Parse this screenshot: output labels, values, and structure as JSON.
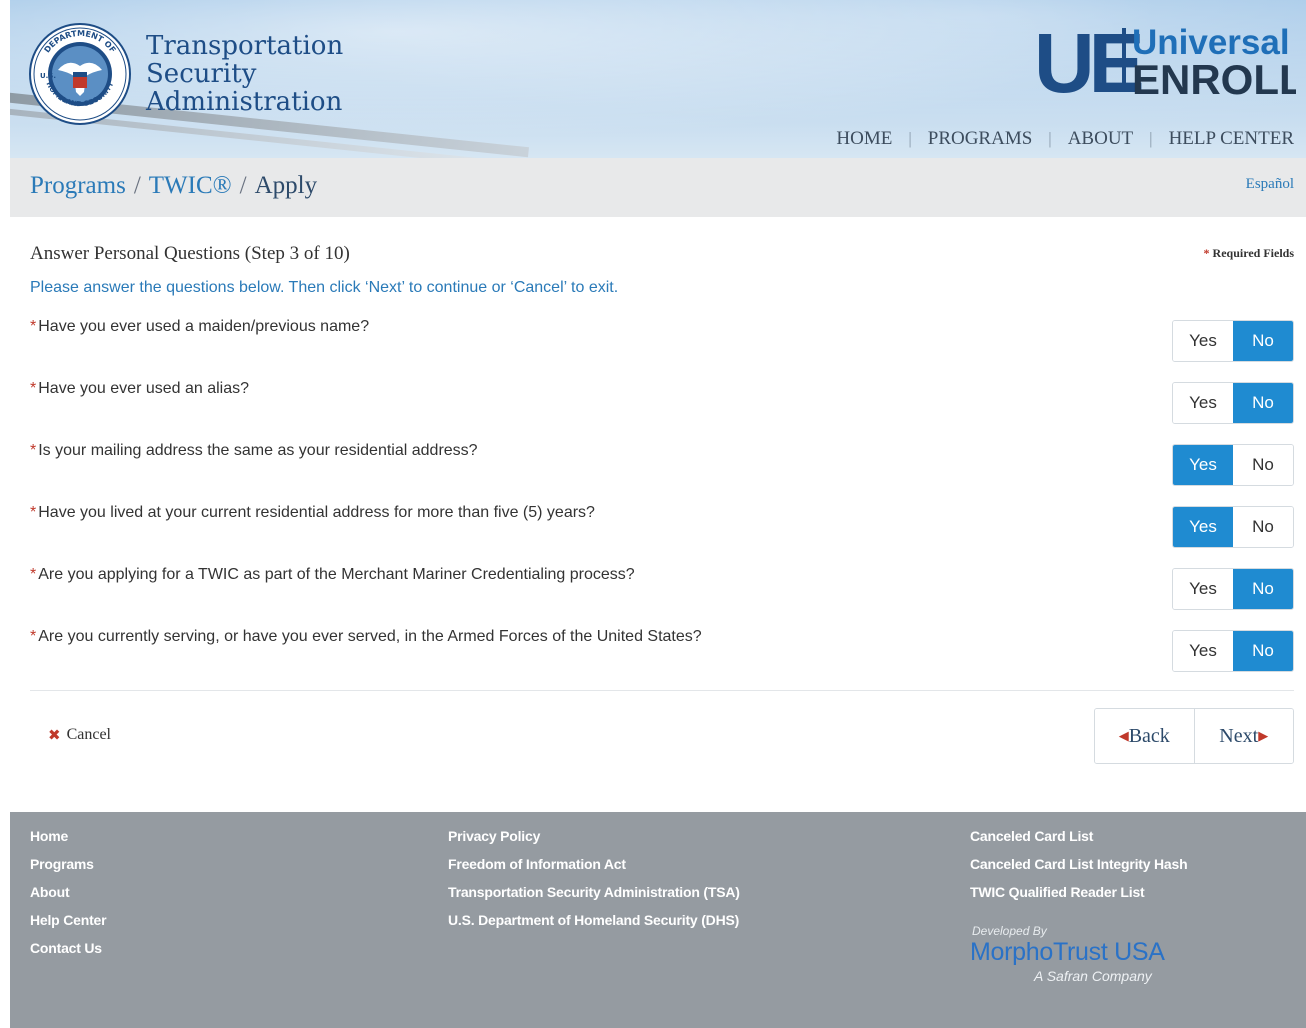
{
  "header": {
    "tsa_line1": "Transportation",
    "tsa_line2": "Security",
    "tsa_line3": "Administration",
    "seal_text_top": "DEPARTMENT OF",
    "seal_text_bottom": "HOMELAND SECURITY",
    "seal_text_left": "U.S.",
    "ue_mark": "UE",
    "ue_line1": "Universal",
    "ue_line2": "ENROLL",
    "nav": [
      "HOME",
      "PROGRAMS",
      "ABOUT",
      "HELP CENTER"
    ]
  },
  "breadcrumb": {
    "items": [
      "Programs",
      "TWIC®"
    ],
    "current": "Apply",
    "language_link": "Español"
  },
  "form": {
    "step_title": "Answer Personal Questions (Step 3 of 10)",
    "required_note_star": "*",
    "required_note": "Required Fields",
    "instructions": "Please answer the questions below. Then click ‘Next’ to continue or ‘Cancel’ to exit.",
    "yes_label": "Yes",
    "no_label": "No",
    "questions": [
      {
        "text": "Have you ever used a maiden/previous name?",
        "selected": "No"
      },
      {
        "text": "Have you ever used an alias?",
        "selected": "No"
      },
      {
        "text": "Is your mailing address the same as your residential address?",
        "selected": "Yes"
      },
      {
        "text": "Have you lived at your current residential address for more than five (5) years?",
        "selected": "Yes"
      },
      {
        "text": "Are you applying for a TWIC as part of the Merchant Mariner Credentialing process?",
        "selected": "No"
      },
      {
        "text": "Are you currently serving, or have you ever served, in the Armed Forces of the United States?",
        "selected": "No"
      }
    ],
    "cancel_label": "Cancel",
    "back_label": "Back",
    "next_label": "Next"
  },
  "footer": {
    "col1": [
      "Home",
      "Programs",
      "About",
      "Help Center",
      "Contact Us"
    ],
    "col2": [
      "Privacy Policy",
      "Freedom of Information Act",
      "Transportation Security Administration (TSA)",
      "U.S. Department of Homeland Security (DHS)"
    ],
    "col3": [
      "Canceled Card List",
      "Canceled Card List Integrity Hash",
      "TWIC Qualified Reader List"
    ],
    "developed_by": "Developed By",
    "developer": "MorphoTrust USA",
    "developer_tagline": "A Safran Company"
  },
  "colors": {
    "accent": "#1f8bd1",
    "link": "#2a7ab8",
    "required": "#c0392b",
    "footer_bg": "#959ba1"
  }
}
